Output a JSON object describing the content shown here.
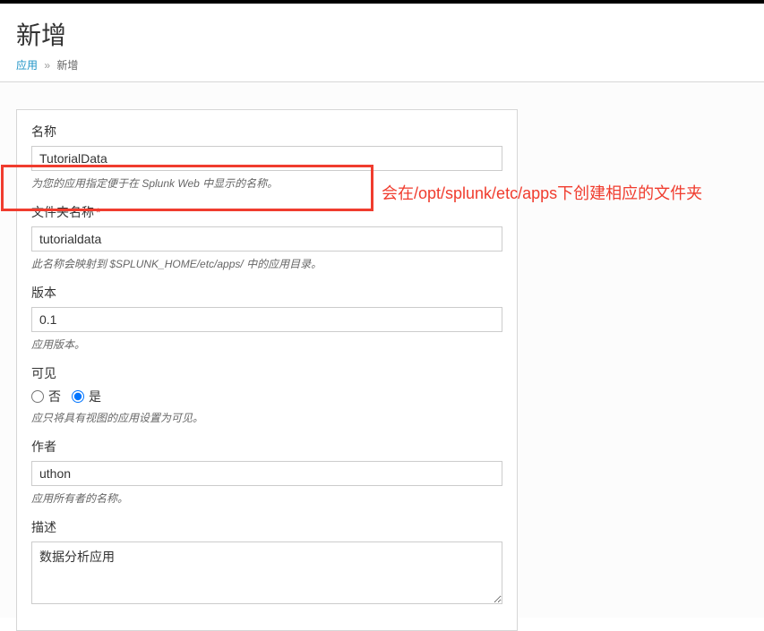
{
  "header": {
    "pageTitle": "新增",
    "breadcrumbLink": "应用",
    "breadcrumbCurrent": "新增"
  },
  "form": {
    "name": {
      "label": "名称",
      "value": "TutorialData",
      "help": "为您的应用指定便于在 Splunk Web 中显示的名称。"
    },
    "folder": {
      "label": "文件夹名称",
      "value": "tutorialdata",
      "help": "此名称会映射到 $SPLUNK_HOME/etc/apps/ 中的应用目录。"
    },
    "version": {
      "label": "版本",
      "value": "0.1",
      "help": "应用版本。"
    },
    "visible": {
      "label": "可见",
      "optNo": "否",
      "optYes": "是",
      "help": "应只将具有视图的应用设置为可见。"
    },
    "author": {
      "label": "作者",
      "value": "uthon",
      "help": "应用所有者的名称。"
    },
    "description": {
      "label": "描述",
      "value": "数据分析应用"
    }
  },
  "annotation": {
    "text": "会在/opt/splunk/etc/apps下创建相应的文件夹"
  }
}
